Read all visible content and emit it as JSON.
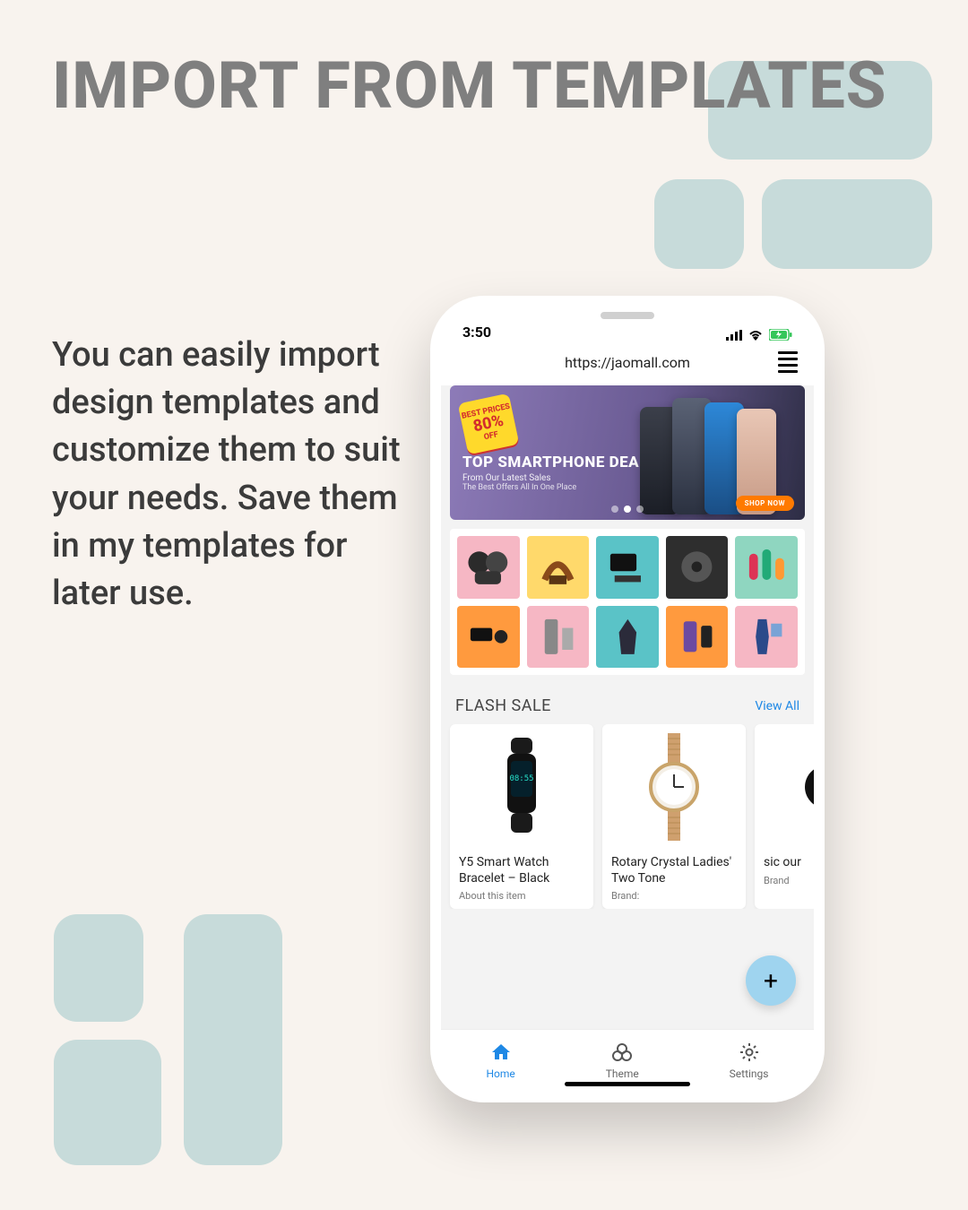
{
  "heading": "IMPORT FROM TEMPLATES",
  "body": "You can easily import design templates and customize them to suit your needs. Save them in my templates for later use.",
  "status": {
    "time": "3:50"
  },
  "url": "https://jaomall.com",
  "banner": {
    "badge_top": "BEST PRICES",
    "badge_pct": "80%",
    "badge_off": "OFF",
    "title": "TOP SMARTPHONE DEALS",
    "subtitle": "From Our Latest Sales",
    "subtitle2": "The Best Offers All In One Place",
    "cta": "SHOP NOW"
  },
  "section": {
    "title": "FLASH SALE",
    "view_all": "View All"
  },
  "products": [
    {
      "name": "Y5 Smart Watch Bracelet – Black",
      "sub": "About this item"
    },
    {
      "name": "Rotary Crystal Ladies' Two Tone",
      "sub": "Brand:"
    },
    {
      "name": "sic our",
      "sub": "Brand"
    }
  ],
  "tabs": {
    "home": "Home",
    "theme": "Theme",
    "settings": "Settings"
  },
  "fab": "+"
}
